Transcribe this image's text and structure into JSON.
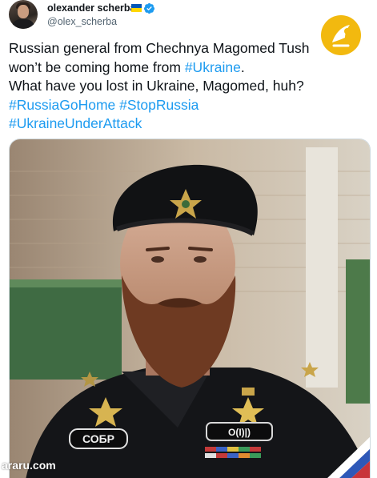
{
  "user": {
    "display_name": "olexander scherba",
    "handle": "@olex_scherba",
    "verified": true,
    "avatar_icon": "profile-photo"
  },
  "tweet": {
    "lines": [
      {
        "text": "Russian general from Chechnya Magomed Tush",
        "tag": ""
      },
      {
        "text": "won’t be coming home from ",
        "tag": "#Ukraine",
        "suffix": "."
      },
      {
        "text": "What have you lost in Ukraine, Magomed, huh?",
        "tag": ""
      },
      {
        "text": "",
        "tag": "#RussiaGoHome #StopRussia"
      },
      {
        "text": "",
        "tag": "#UkraineUnderAttack"
      }
    ]
  },
  "media": {
    "patch_text": "СОБР",
    "badge_text": "O(I)|)"
  },
  "watermark": "araru.com",
  "colors": {
    "accent": "#1d9bf0",
    "text": "#0f1419",
    "secondary_text": "#536471",
    "logo_badge": "#f2b90f",
    "flag_blue": "#0057b7",
    "flag_yellow": "#ffd700"
  }
}
